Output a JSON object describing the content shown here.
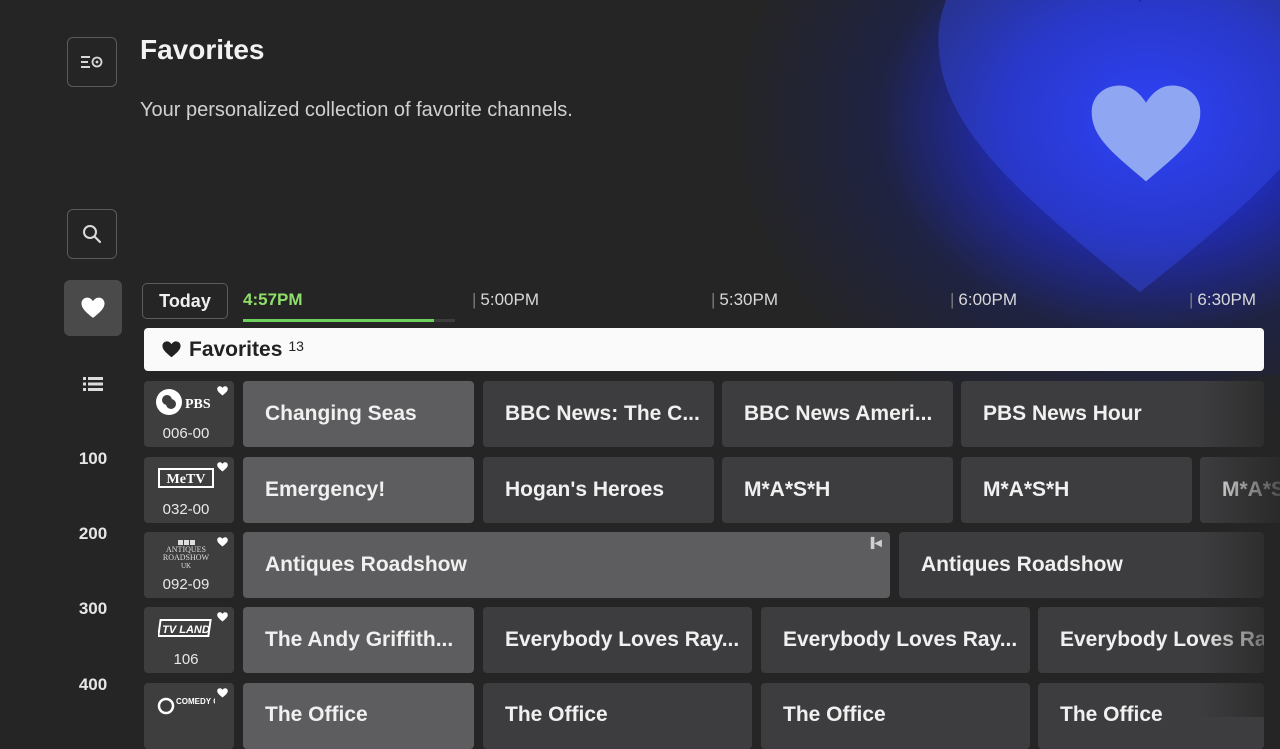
{
  "page": {
    "title": "Favorites",
    "subtitle": "Your personalized collection of favorite channels."
  },
  "rail": {
    "numbers": [
      "100",
      "200",
      "300",
      "400"
    ]
  },
  "timebar": {
    "today_label": "Today",
    "now_time": "4:57PM",
    "now_progress_fraction": 0.9,
    "ticks": [
      "5:00PM",
      "5:30PM",
      "6:00PM",
      "6:30PM"
    ]
  },
  "category": {
    "label": "Favorites",
    "count": "13"
  },
  "channels": [
    {
      "number": "006-00",
      "logo_text": "PBS",
      "programs": [
        "Changing Seas",
        "BBC News: The C...",
        "BBC News Ameri...",
        "PBS News Hour"
      ]
    },
    {
      "number": "032-00",
      "logo_text": "MeTV",
      "programs": [
        "Emergency!",
        "Hogan's Heroes",
        "M*A*S*H",
        "M*A*S*H",
        "M*A*S*H"
      ]
    },
    {
      "number": "092-09",
      "logo_text": "ANTIQUES ROADSHOW",
      "logo_subtext": "UK",
      "programs": [
        "Antiques Roadshow",
        "Antiques Roadshow"
      ]
    },
    {
      "number": "106",
      "logo_text": "TV LAND",
      "programs": [
        "The Andy Griffith...",
        "Everybody Loves Ray...",
        "Everybody Loves Ray...",
        "Everybody Loves Ra"
      ]
    },
    {
      "number": "",
      "logo_text": "COMEDY CENTRAL",
      "programs": [
        "The Office",
        "The Office",
        "The Office",
        "The Office"
      ]
    }
  ],
  "colors": {
    "accent_green": "#8fdf6a",
    "glow_blue": "#2a3cff"
  },
  "icons": [
    "guide-settings-icon",
    "search-icon",
    "heart-icon",
    "list-icon",
    "restart-icon"
  ]
}
